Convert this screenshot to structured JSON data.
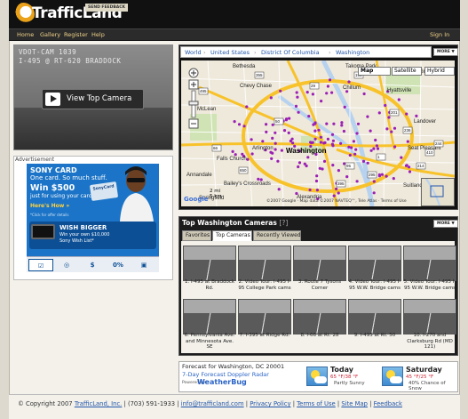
{
  "header": {
    "logo_text": "TrafficLand",
    "feedback_label": "SEND FEEDBACK",
    "nav": [
      "Home",
      "Gallery",
      "Register",
      "Help"
    ],
    "signin": "Sign In"
  },
  "camera": {
    "overlay_line1": "VDOT-CAM 1039",
    "overlay_line2": "I-495 @ RT-620 BRADDOCK",
    "view_button": "View Top Camera"
  },
  "ad": {
    "label": "Advertisement",
    "brand": "SONY CARD",
    "tagline": "One card. So much stuff.",
    "headline": "Win $500",
    "sub": "just for using your card*",
    "howto": "Here's How »",
    "fineprint": "*Click for offer details",
    "card_label": "SonyCard",
    "wish_title": "WISH BIGGER",
    "wish_text1": "Win your own $10,000",
    "wish_text2": "Sony Wish List*",
    "tabs": [
      "☑",
      "◎",
      "$",
      "0%",
      "▣"
    ]
  },
  "map": {
    "breadcrumbs": [
      "World",
      "United States",
      "District Of Columbia",
      "Washington"
    ],
    "more": "MORE ▼",
    "types": [
      "Map",
      "Satellite",
      "Hybrid"
    ],
    "scale1": "2 mi",
    "scale2": "5 km",
    "brand": "Google",
    "terms": "©2007 Google · Map data ©2007 NAVTEQ™, Tele Atlas · Terms of Use",
    "places": [
      {
        "name": "Bethesda",
        "color": "#222"
      },
      {
        "name": "Takoma Park",
        "color": "#222"
      },
      {
        "name": "McLean",
        "color": "#222"
      },
      {
        "name": "Hyattsville",
        "color": "#222"
      },
      {
        "name": "Chillum",
        "color": "#222"
      },
      {
        "name": "Chevy Chase",
        "color": "#222"
      },
      {
        "name": "Washington",
        "color": "#000"
      },
      {
        "name": "Falls Church",
        "color": "#222"
      },
      {
        "name": "Arlington",
        "color": "#222"
      },
      {
        "name": "Landover",
        "color": "#222"
      },
      {
        "name": "Bailey's Crossroads",
        "color": "#222"
      },
      {
        "name": "Alexandria",
        "color": "#222"
      },
      {
        "name": "Suitland-Silver Hill",
        "color": "#222"
      },
      {
        "name": "Annandale",
        "color": "#222"
      },
      {
        "name": "Greenbelt",
        "color": "#222"
      },
      {
        "name": "Springfield",
        "color": "#222"
      },
      {
        "name": "Seat Pleasant",
        "color": "#222"
      }
    ],
    "routes": [
      "355",
      "495",
      "29",
      "1",
      "50",
      "295",
      "395",
      "66",
      "95",
      "201",
      "214",
      "236",
      "244",
      "410",
      "650",
      "193"
    ]
  },
  "cameras": {
    "title": "Top Washington Cameras",
    "count": "[?]",
    "more": "MORE ▼",
    "tabs": [
      "Favorites",
      "Top Cameras",
      "Recently Viewed"
    ],
    "items": [
      "1. I-495 at Braddock Rd.",
      "2. Video Tour: I-495 I-95 College Park cams",
      "3. Route 7 Tysons Corner",
      "4. Video Tour: I-495 I-95 W.W. Bridge cams",
      "5. Video Tour: I-495 I-95 W.W. Bridge cams",
      "6. Pennsylvania Ave. and Minnesota Ave. SE",
      "7. I-395 at Ridge Rd.",
      "8. I-66 at Rt. 28",
      "9. I-495 at Rt. 50",
      "10. I-270 and Clarksburg Rd (MD 121)"
    ]
  },
  "forecast": {
    "title": "Forecast for Washington, DC 20001",
    "links": "7-Day Forecast   Doppler Radar",
    "powered": "Powered by",
    "brand": "WeatherBug",
    "today": {
      "day": "Today",
      "temp": "65 °F/38 °F",
      "desc": "Partly Sunny"
    },
    "saturday": {
      "day": "Saturday",
      "temp": "45 °F/25 °F",
      "desc1": "40% Chance of",
      "desc2": "Snow"
    }
  },
  "footer": {
    "copyright": "© Copyright 2007",
    "company": "TrafficLand, Inc.",
    "phone": " | (703) 591-1933 | ",
    "email": "info@trafficland.com",
    "privacy": "Privacy Policy",
    "terms": "Terms of Use",
    "sitemap": "Site Map",
    "feedback": "Feedback"
  },
  "colors": {
    "header_bg": "#111111",
    "nav_text": "#f0d38a",
    "camera_dots": "#9b1fb5",
    "link": "#2255aa"
  }
}
